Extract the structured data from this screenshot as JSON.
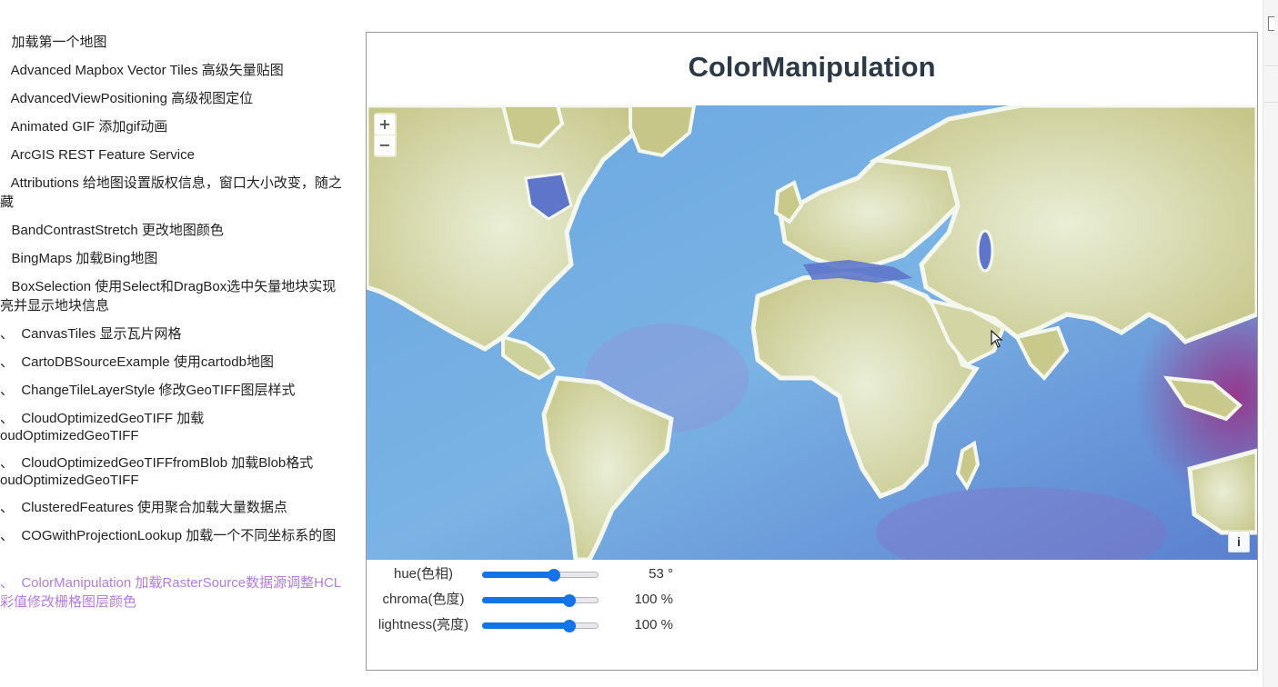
{
  "sidebar": {
    "items": [
      {
        "label": "   加载第一个地图"
      },
      {
        "label": "   Advanced Mapbox Vector Tiles 高级矢量贴图"
      },
      {
        "label": "   AdvancedViewPositioning 高级视图定位"
      },
      {
        "label": "   Animated GIF 添加gif动画"
      },
      {
        "label": "   ArcGIS REST Feature Service"
      },
      {
        "label": "   Attributions 给地图设置版权信息，窗口大小改变，随之"
      },
      {
        "label": "藏"
      },
      {
        "label": "   BandContrastStretch 更改地图颜色"
      },
      {
        "label": "   BingMaps 加载Bing地图"
      },
      {
        "label": "   BoxSelection 使用Select和DragBox选中矢量地块实现"
      },
      {
        "label": "亮并显示地块信息"
      },
      {
        "label": "、  CanvasTiles 显示瓦片网格"
      },
      {
        "label": "、  CartoDBSourceExample 使用cartodb地图"
      },
      {
        "label": "、  ChangeTileLayerStyle 修改GeoTIFF图层样式"
      },
      {
        "label": "、  CloudOptimizedGeoTIFF 加载"
      },
      {
        "label": "oudOptimizedGeoTIFF"
      },
      {
        "label": "、  CloudOptimizedGeoTIFFfromBlob 加载Blob格式"
      },
      {
        "label": "oudOptimizedGeoTIFF"
      },
      {
        "label": "、  ClusteredFeatures 使用聚合加载大量数据点"
      },
      {
        "label": "、  COGwithProjectionLookup 加载一个不同坐标系的图"
      },
      {
        "label": "、  ColorManipulation 加载RasterSource数据源调整HCL"
      },
      {
        "label": "彩值修改栅格图层颜色"
      }
    ]
  },
  "page": {
    "title": "ColorManipulation"
  },
  "map": {
    "zoom_in": "+",
    "zoom_out": "−",
    "attribution": "i",
    "colors": {
      "ocean": "#6fa8de",
      "ocean_deep": "#5b7fd0",
      "land": "#c9c98c",
      "land_light": "#e7ecd2",
      "coast": "#f4f7ee",
      "purple": "#9b3c8c"
    }
  },
  "controls": [
    {
      "label": "hue(色相)",
      "value": "53 °",
      "fraction": 0.62
    },
    {
      "label": "chroma(色度)",
      "value": "100 %",
      "fraction": 0.75
    },
    {
      "label": "lightness(亮度)",
      "value": "100 %",
      "fraction": 0.75
    }
  ],
  "colors": {
    "accent": "#1473e6",
    "active_link": "#b57be0",
    "title": "#2b3a46"
  }
}
